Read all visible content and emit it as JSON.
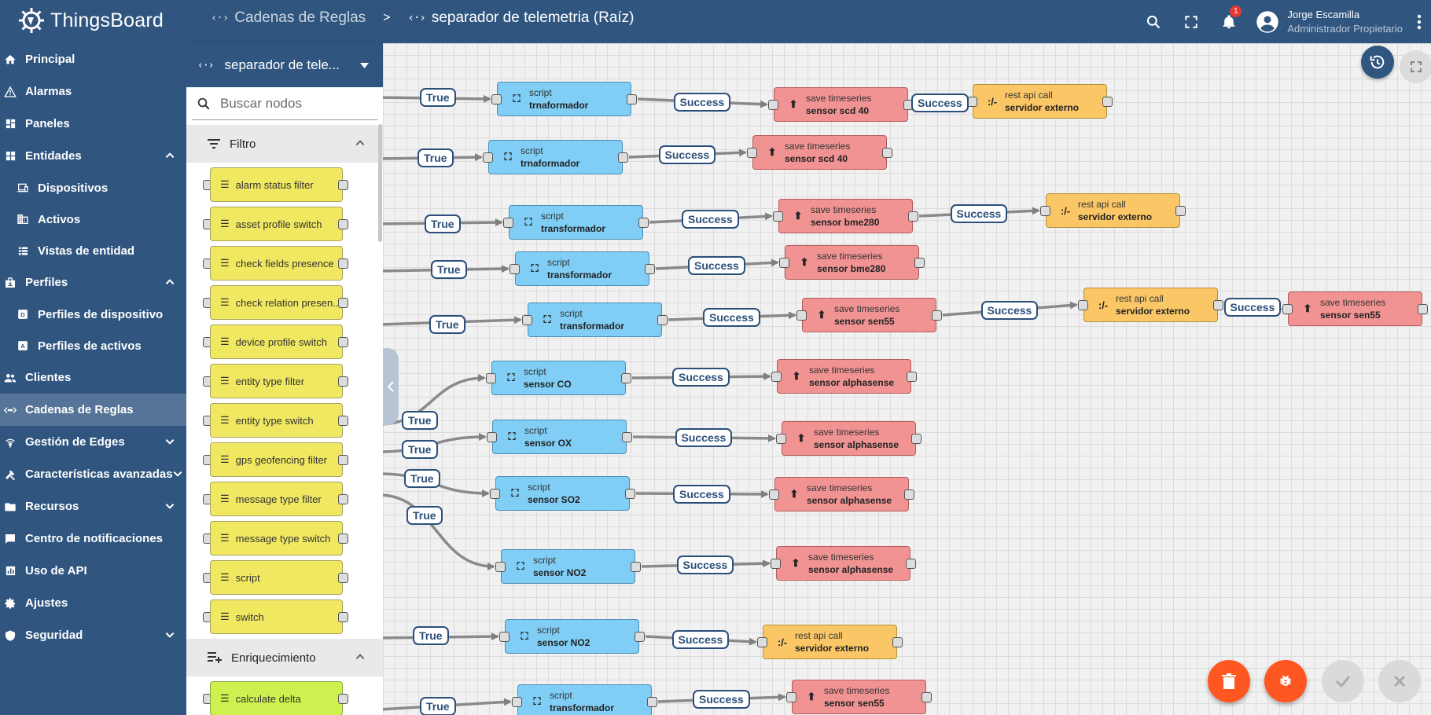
{
  "header": {
    "logo_text": "ThingsBoard",
    "breadcrumb_parent": "Cadenas de Reglas",
    "breadcrumb_separator": ">",
    "breadcrumb_current": "separador de telemetria (Raíz)",
    "notification_count": "1",
    "user_name": "Jorge Escamilla",
    "user_role": "Administrador Propietario"
  },
  "sidebar": {
    "items": [
      {
        "label": "Principal"
      },
      {
        "label": "Alarmas"
      },
      {
        "label": "Paneles"
      },
      {
        "label": "Entidades"
      },
      {
        "label": "Dispositivos"
      },
      {
        "label": "Activos"
      },
      {
        "label": "Vistas de entidad"
      },
      {
        "label": "Perfiles"
      },
      {
        "label": "Perfiles de dispositivo"
      },
      {
        "label": "Perfiles de activos"
      },
      {
        "label": "Clientes"
      },
      {
        "label": "Cadenas de Reglas"
      },
      {
        "label": "Gestión de Edges"
      },
      {
        "label": "Características avanzadas"
      },
      {
        "label": "Recursos"
      },
      {
        "label": "Centro de notificaciones"
      },
      {
        "label": "Uso de API"
      },
      {
        "label": "Ajustes"
      },
      {
        "label": "Seguridad"
      }
    ]
  },
  "library": {
    "selected_chain": "separador de tele...",
    "search_placeholder": "Buscar nodos",
    "filter_section": "Filtro",
    "filter_nodes": [
      "alarm status filter",
      "asset profile switch",
      "check fields presence",
      "check relation presen...",
      "device profile switch",
      "entity type filter",
      "entity type switch",
      "gps geofencing filter",
      "message type filter",
      "message type switch",
      "script",
      "switch"
    ],
    "enrichment_section": "Enriquecimiento",
    "enrichment_nodes": [
      "calculate delta"
    ]
  },
  "canvas": {
    "labels": {
      "true": "True",
      "success": "Success"
    },
    "node_types": {
      "script": "script",
      "save": "save timeseries",
      "rest": "rest api call"
    },
    "node_names": {
      "trnaformador": "trnaformador",
      "transformador": "transformador",
      "sensor_co": "sensor CO",
      "sensor_ox": "sensor OX",
      "sensor_so2": "sensor SO2",
      "sensor_no2": "sensor NO2",
      "sensor_scd40": "sensor scd 40",
      "sensor_bme280": "sensor bme280",
      "sensor_sen55": "sensor sen55",
      "sensor_alphasense": "sensor alphasense",
      "servidor_externo": "servidor externo"
    }
  },
  "colors": {
    "primary": "#305680",
    "script_node": "#80cef5",
    "save_node": "#f19393",
    "rest_node": "#fbc766",
    "filter_node": "#f1e862",
    "enrichment_node": "#cdf14e",
    "fab_orange": "#ff5722"
  }
}
